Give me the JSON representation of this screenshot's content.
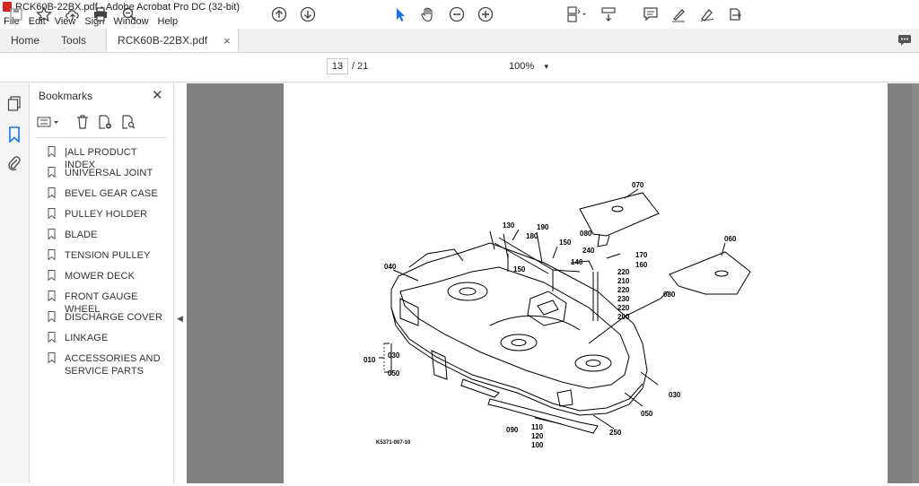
{
  "window": {
    "title": "RCK60B-22BX.pdf - Adobe Acrobat Pro DC (32-bit)"
  },
  "menu": [
    "File",
    "Edit",
    "View",
    "Sign",
    "Window",
    "Help"
  ],
  "tabs": {
    "home": "Home",
    "tools": "Tools",
    "doc": "RCK60B-22BX.pdf",
    "doc_close": "×"
  },
  "toolbar": {
    "page_current": "13",
    "page_total": "/ 21",
    "zoom": "100%",
    "zoom_caret": "▾"
  },
  "bookmarks": {
    "title": "Bookmarks",
    "close": "✕",
    "items": [
      {
        "label": "|ALL PRODUCT INDEX"
      },
      {
        "label": "UNIVERSAL JOINT"
      },
      {
        "label": "BEVEL GEAR CASE"
      },
      {
        "label": "PULLEY HOLDER"
      },
      {
        "label": "BLADE"
      },
      {
        "label": "TENSION PULLEY"
      },
      {
        "label": "MOWER DECK"
      },
      {
        "label": "FRONT GAUGE WHEEL"
      },
      {
        "label": "DISCHARGE COVER"
      },
      {
        "label": "LINKAGE"
      },
      {
        "label": "ACCESSORIES AND SERVICE PARTS"
      }
    ]
  },
  "diagram": {
    "parts": [
      "070",
      "130",
      "190",
      "180",
      "150",
      "080",
      "240",
      "170",
      "160",
      "060",
      "040",
      "150",
      "140",
      "220",
      "210",
      "220",
      "230",
      "220",
      "200",
      "080",
      "010",
      "030",
      "050",
      "030",
      "050",
      "110",
      "120",
      "100",
      "090",
      "250"
    ],
    "code": "K5371-007-10"
  },
  "colors": {
    "accent": "#1a73e8",
    "canvas": "#808080",
    "pdf_red": "#d4251f"
  }
}
